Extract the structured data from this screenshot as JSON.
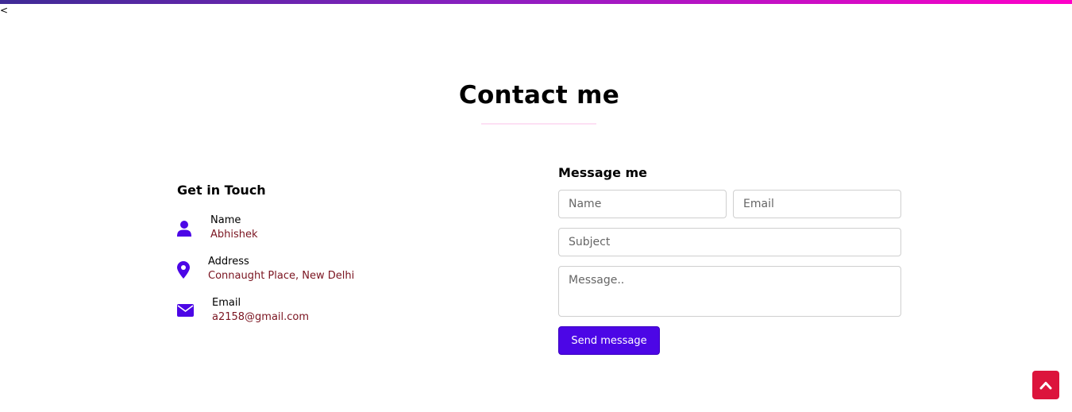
{
  "page": {
    "stray_char": "<",
    "title": "Contact me"
  },
  "info": {
    "heading": "Get in Touch",
    "items": [
      {
        "icon": "user-icon",
        "label": "Name",
        "value": "Abhishek"
      },
      {
        "icon": "map-marker-icon",
        "label": "Address",
        "value": "Connaught Place, New Delhi"
      },
      {
        "icon": "envelope-icon",
        "label": "Email",
        "value": "a2158@gmail.com"
      }
    ]
  },
  "form": {
    "heading": "Message me",
    "name_placeholder": "Name",
    "email_placeholder": "Email",
    "subject_placeholder": "Subject",
    "message_placeholder": "Message..",
    "send_label": "Send message"
  },
  "scroll_top": {
    "icon": "chevron-up-icon"
  },
  "colors": {
    "accent": "#4c06e6",
    "icon": "#4c06e6",
    "value_text": "#7a1420",
    "scroll_top": "#dc143c"
  }
}
